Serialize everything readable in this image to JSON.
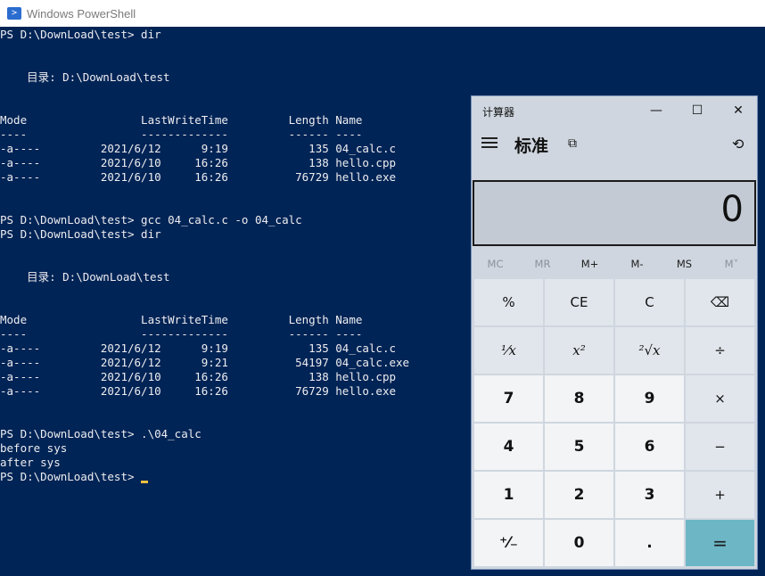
{
  "powershell": {
    "title": "Windows PowerShell",
    "icon": "powershell-icon",
    "colors": {
      "background": "#012456",
      "text": "#eeedf0",
      "cursor": "#f0c040"
    },
    "lines": [
      "PS D:\\DownLoad\\test> dir",
      "",
      "",
      "    目录: D:\\DownLoad\\test",
      "",
      "",
      "Mode                 LastWriteTime         Length Name",
      "----                 -------------         ------ ----",
      "-a----         2021/6/12      9:19            135 04_calc.c",
      "-a----         2021/6/10     16:26            138 hello.cpp",
      "-a----         2021/6/10     16:26          76729 hello.exe",
      "",
      "",
      "PS D:\\DownLoad\\test> gcc 04_calc.c -o 04_calc",
      "PS D:\\DownLoad\\test> dir",
      "",
      "",
      "    目录: D:\\DownLoad\\test",
      "",
      "",
      "Mode                 LastWriteTime         Length Name",
      "----                 -------------         ------ ----",
      "-a----         2021/6/12      9:19            135 04_calc.c",
      "-a----         2021/6/12      9:21          54197 04_calc.exe",
      "-a----         2021/6/10     16:26            138 hello.cpp",
      "-a----         2021/6/10     16:26          76729 hello.exe",
      "",
      "",
      "PS D:\\DownLoad\\test> .\\04_calc",
      "before sys",
      "after sys"
    ],
    "prompt": "PS D:\\DownLoad\\test> "
  },
  "calculator": {
    "title": "计算器",
    "mode": "标准",
    "display_value": "0",
    "window_controls": {
      "minimize": "—",
      "maximize": "☐",
      "close": "✕"
    },
    "icons": {
      "menu": "hamburger-icon",
      "keep_on_top": "keep-on-top-icon",
      "history": "history-icon"
    },
    "memory": [
      {
        "label": "MC",
        "enabled": false
      },
      {
        "label": "MR",
        "enabled": false
      },
      {
        "label": "M+",
        "enabled": true
      },
      {
        "label": "M-",
        "enabled": true
      },
      {
        "label": "MS",
        "enabled": true
      },
      {
        "label": "M˅",
        "enabled": false
      }
    ],
    "keys": [
      {
        "label": "%",
        "kind": "op",
        "name": "percent-button"
      },
      {
        "label": "CE",
        "kind": "op",
        "name": "clear-entry-button"
      },
      {
        "label": "C",
        "kind": "op",
        "name": "clear-button"
      },
      {
        "label": "⌫",
        "kind": "op",
        "name": "backspace-button"
      },
      {
        "label": "¹⁄x",
        "kind": "op fn",
        "name": "reciprocal-button"
      },
      {
        "label": "x²",
        "kind": "op fn",
        "name": "square-button"
      },
      {
        "label": "²√x",
        "kind": "op fn",
        "name": "square-root-button"
      },
      {
        "label": "÷",
        "kind": "op",
        "name": "divide-button"
      },
      {
        "label": "7",
        "kind": "num",
        "name": "digit-7-button"
      },
      {
        "label": "8",
        "kind": "num",
        "name": "digit-8-button"
      },
      {
        "label": "9",
        "kind": "num",
        "name": "digit-9-button"
      },
      {
        "label": "×",
        "kind": "op",
        "name": "multiply-button"
      },
      {
        "label": "4",
        "kind": "num",
        "name": "digit-4-button"
      },
      {
        "label": "5",
        "kind": "num",
        "name": "digit-5-button"
      },
      {
        "label": "6",
        "kind": "num",
        "name": "digit-6-button"
      },
      {
        "label": "−",
        "kind": "op",
        "name": "minus-button"
      },
      {
        "label": "1",
        "kind": "num",
        "name": "digit-1-button"
      },
      {
        "label": "2",
        "kind": "num",
        "name": "digit-2-button"
      },
      {
        "label": "3",
        "kind": "num",
        "name": "digit-3-button"
      },
      {
        "label": "+",
        "kind": "op",
        "name": "plus-button"
      },
      {
        "label": "⁺⁄₋",
        "kind": "num",
        "name": "negate-button"
      },
      {
        "label": "0",
        "kind": "num",
        "name": "digit-0-button"
      },
      {
        "label": ".",
        "kind": "num",
        "name": "decimal-button"
      },
      {
        "label": "=",
        "kind": "eq",
        "name": "equals-button"
      }
    ],
    "colors": {
      "background": "#cfd6df",
      "equals": "#6cb6c6",
      "digit_key": "#f2f4f6",
      "op_key": "#e1e6ec"
    }
  }
}
